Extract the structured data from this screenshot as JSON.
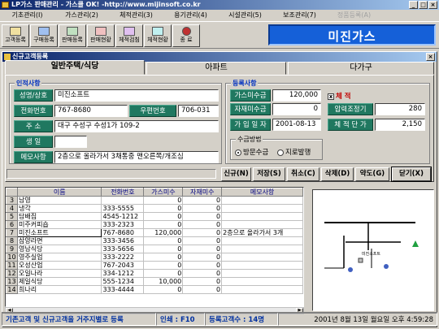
{
  "window": {
    "title": "LP가스 판매관리 - 가스클 OK! -http://www.mijinsoft.co.kr"
  },
  "menu": [
    {
      "label": "기초관리(I)",
      "enabled": true
    },
    {
      "label": "가스관리(2)",
      "enabled": true
    },
    {
      "label": "체적관리(3)",
      "enabled": true
    },
    {
      "label": "용기관리(4)",
      "enabled": true
    },
    {
      "label": "시설관리(5)",
      "enabled": true
    },
    {
      "label": "보조관리(7)",
      "enabled": true
    },
    {
      "label": "정품등록(A)",
      "enabled": false
    }
  ],
  "toolbar": {
    "buttons": [
      {
        "label": "고객등록",
        "icon": "customer-icon"
      },
      {
        "label": "구매등록",
        "icon": "purchase-icon"
      },
      {
        "label": "판매등록",
        "icon": "sales-icon"
      },
      {
        "label": "판매현황",
        "icon": "report-icon"
      },
      {
        "label": "체적검침",
        "icon": "meter-icon"
      },
      {
        "label": "체적현황",
        "icon": "chart-icon"
      },
      {
        "label": "종 료",
        "icon": "exit-icon"
      }
    ],
    "brand": "미진가스"
  },
  "form_window": {
    "title": "신규고객등록"
  },
  "tabs": [
    {
      "label": "일반주택/식당",
      "active": true
    },
    {
      "label": "아파트",
      "active": false
    },
    {
      "label": "다가구",
      "active": false
    }
  ],
  "personal": {
    "group_title": "인적사항",
    "name_label": "성명/상호",
    "name_value": "미진소프트",
    "phone_label": "전화번호",
    "phone_value": "767-8680",
    "zip_label": "우편번호",
    "zip_value": "706-031",
    "address_label": "주 소",
    "address_value": "대구 수성구 수성1가 109-2",
    "birth_label": "생 일",
    "birth_value": "",
    "memo_label": "메모사항",
    "memo_value": "2층으로 올라가서 3채통중 맨오른쪽/개조심"
  },
  "registration": {
    "group_title": "등록사항",
    "gas_deposit_label": "가스미수금",
    "gas_deposit_value": "120,000",
    "material_deposit_label": "자재미수금",
    "material_deposit_value": "0",
    "join_date_label": "가 입 일 자",
    "join_date_value": "2001-08-13",
    "volume_checkbox_label": "체 적",
    "volume_checked": true,
    "pressure_label": "압력조정기",
    "pressure_value": "280",
    "unit_price_label": "체 적 단 가",
    "unit_price_value": "2,150",
    "collection_group": "수금방법",
    "collection_options": [
      {
        "label": "방문수금",
        "selected": true
      },
      {
        "label": "지로발행",
        "selected": false
      }
    ]
  },
  "actions": [
    {
      "label": "신규(N)",
      "name": "new-button"
    },
    {
      "label": "저장(S)",
      "name": "save-button"
    },
    {
      "label": "취소(C)",
      "name": "cancel-button"
    },
    {
      "label": "삭제(D)",
      "name": "delete-button"
    },
    {
      "label": "약도(G)",
      "name": "map-button"
    },
    {
      "label": "닫기(X)",
      "name": "close-button"
    }
  ],
  "grid": {
    "columns": [
      "이름",
      "전화번호",
      "가스미수",
      "자재미수",
      "메모사항"
    ],
    "rows": [
      {
        "n": "3",
        "name": "남영",
        "phone": "",
        "gas": "0",
        "mat": "0",
        "memo": ""
      },
      {
        "n": "4",
        "name": "냉각",
        "phone": "333-5555",
        "gas": "0",
        "mat": "0",
        "memo": ""
      },
      {
        "n": "5",
        "name": "담배집",
        "phone": "4545-1212",
        "gas": "0",
        "mat": "0",
        "memo": ""
      },
      {
        "n": "6",
        "name": "미주커피숍",
        "phone": "333-2323",
        "gas": "0",
        "mat": "0",
        "memo": ""
      },
      {
        "n": "7",
        "name": "미진소프트",
        "phone": "767-8680",
        "gas": "120,000",
        "mat": "0",
        "memo": "2층으로 올라가서 3개",
        "selected": true
      },
      {
        "n": "8",
        "name": "삼양라면",
        "phone": "333-3456",
        "gas": "0",
        "mat": "0",
        "memo": ""
      },
      {
        "n": "9",
        "name": "영남식당",
        "phone": "333-5656",
        "gas": "0",
        "mat": "0",
        "memo": ""
      },
      {
        "n": "10",
        "name": "영주실업",
        "phone": "333-2222",
        "gas": "0",
        "mat": "0",
        "memo": ""
      },
      {
        "n": "11",
        "name": "오성산업",
        "phone": "767-2043",
        "gas": "0",
        "mat": "0",
        "memo": ""
      },
      {
        "n": "12",
        "name": "오일나라",
        "phone": "334-1212",
        "gas": "0",
        "mat": "0",
        "memo": ""
      },
      {
        "n": "13",
        "name": "제일식당",
        "phone": "555-1234",
        "gas": "10,000",
        "mat": "0",
        "memo": ""
      },
      {
        "n": "14",
        "name": "희나리",
        "phone": "333-4444",
        "gas": "0",
        "mat": "0",
        "memo": ""
      }
    ]
  },
  "map": {
    "label": "미진소프트"
  },
  "status": {
    "hint": "기존고객 및 신규고객을 거주지별로 등록",
    "print": "인쇄 : F10",
    "count": "등록고객수 : 14명",
    "datetime": "2001년 8월 13일 월요일 오후 4:59:28"
  }
}
